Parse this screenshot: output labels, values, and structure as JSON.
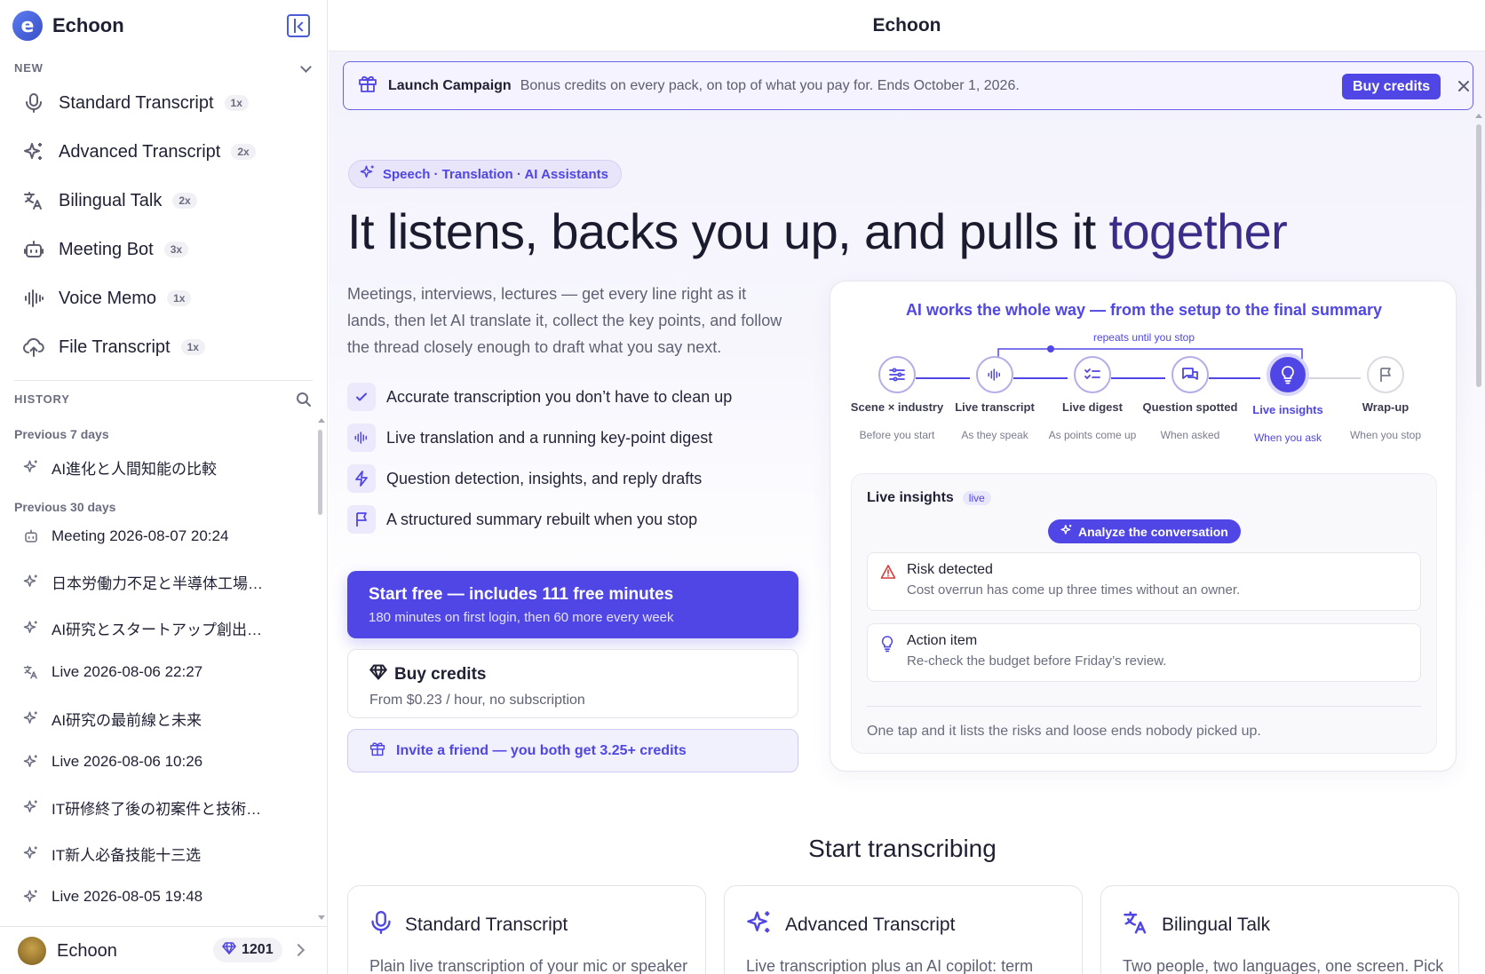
{
  "sidebar": {
    "brand": "Echoon",
    "new_label": "NEW",
    "new_items": [
      {
        "label": "Standard Transcript",
        "badge": "1x",
        "icon": "microphone-icon"
      },
      {
        "label": "Advanced Transcript",
        "badge": "2x",
        "icon": "sparkles-icon"
      },
      {
        "label": "Bilingual Talk",
        "badge": "2x",
        "icon": "translate-icon"
      },
      {
        "label": "Meeting Bot",
        "badge": "3x",
        "icon": "robot-icon"
      },
      {
        "label": "Voice Memo",
        "badge": "1x",
        "icon": "waveform-icon"
      },
      {
        "label": "File Transcript",
        "badge": "1x",
        "icon": "cloud-upload-icon"
      }
    ],
    "history_label": "HISTORY",
    "group_7": "Previous 7 days",
    "group_30": "Previous 30 days",
    "history": [
      {
        "label": "AI進化と人間知能の比較",
        "icon": "sparkles-icon"
      },
      {
        "label": "Meeting 2026-08-07 20:24",
        "icon": "robot-icon"
      },
      {
        "label": "日本労働力不足と半導体工場…",
        "icon": "sparkles-icon"
      },
      {
        "label": "AI研究とスタートアップ創出…",
        "icon": "sparkles-icon"
      },
      {
        "label": "Live 2026-08-06 22:27",
        "icon": "translate-icon"
      },
      {
        "label": "AI研究の最前線と未来",
        "icon": "sparkles-icon"
      },
      {
        "label": "Live 2026-08-06 10:26",
        "icon": "sparkles-icon"
      },
      {
        "label": "IT研修終了後の初案件と技術…",
        "icon": "sparkles-icon"
      },
      {
        "label": "IT新人必备技能十三选",
        "icon": "sparkles-icon"
      },
      {
        "label": "Live 2026-08-05 19:48",
        "icon": "sparkles-icon"
      }
    ],
    "user": {
      "name": "Echoon",
      "credits": "1201"
    }
  },
  "main": {
    "title": "Echoon",
    "banner": {
      "title": "Launch Campaign",
      "text": "Bonus credits on every pack, on top of what you pay for. Ends October 1, 2026.",
      "button": "Buy credits"
    },
    "pill": "Speech · Translation · AI Assistants",
    "hero_main": "It listens, backs you up, and pulls it ",
    "hero_accent": "together",
    "description": "Meetings, interviews, lectures — get every line right as it lands, then let AI translate it, collect the key points, and follow the thread closely enough to draft what you say next.",
    "features": [
      "Accurate transcription you don’t have to clean up",
      "Live translation and a running key-point digest",
      "Question detection, insights, and reply drafts",
      "A structured summary rebuilt when you stop"
    ],
    "cta": {
      "title": "Start free — includes 111 free minutes",
      "subtitle": "180 minutes on first login, then 60 more every week"
    },
    "buy": {
      "title": "Buy credits",
      "subtitle": "From $0.23 / hour, no subscription"
    },
    "invite": "Invite a friend — you both get 3.25+ credits",
    "workflow": {
      "title": "AI works the whole way — from the setup to the final summary",
      "repeat": "repeats until you stop",
      "steps": [
        {
          "name": "Scene × industry",
          "sub": "Before you start",
          "state": "done"
        },
        {
          "name": "Live transcript",
          "sub": "As they speak",
          "state": "done"
        },
        {
          "name": "Live digest",
          "sub": "As points come up",
          "state": "done"
        },
        {
          "name": "Question spotted",
          "sub": "When asked",
          "state": "done"
        },
        {
          "name": "Live insights",
          "sub": "When you ask",
          "state": "active"
        },
        {
          "name": "Wrap-up",
          "sub": "When you stop",
          "state": "todo"
        }
      ],
      "insights_title": "Live insights",
      "insights_badge": "live",
      "analyze": "Analyze the conversation",
      "items": [
        {
          "title": "Risk detected",
          "text": "Cost overrun has come up three times without an owner."
        },
        {
          "title": "Action item",
          "text": "Re-check the budget before Friday’s review."
        }
      ],
      "footer": "One tap and it lists the risks and loose ends nobody picked up."
    },
    "start_title": "Start transcribing",
    "modes": [
      {
        "title": "Standard Transcript",
        "desc": "Plain live transcription of your mic or speaker"
      },
      {
        "title": "Advanced Transcript",
        "desc": "Live transcription plus an AI copilot: term"
      },
      {
        "title": "Bilingual Talk",
        "desc": "Two people, two languages, one screen. Pick"
      }
    ]
  },
  "colors": {
    "accent": "#4f46e5",
    "text": "#1f2033",
    "muted": "#6b6d80"
  }
}
